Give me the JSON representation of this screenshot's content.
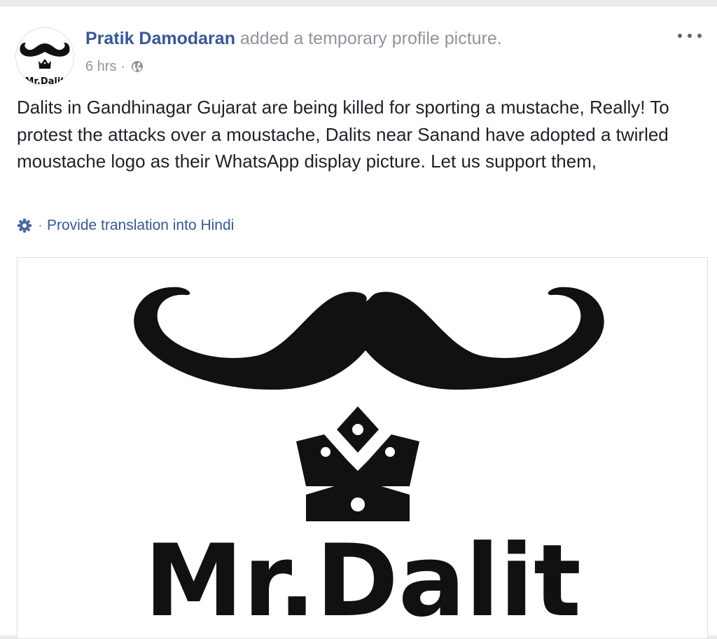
{
  "post": {
    "author_name": "Pratik Damodaran",
    "action_text": "added a temporary profile picture.",
    "time": "6 hrs",
    "separator": "·",
    "privacy_icon": "globe-icon",
    "more_icon": "more-options-icon",
    "body": "Dalits in Gandhinagar Gujarat are being killed for sporting a mustache, Really! To protest the attacks over a moustache, Dalits near Sanand have adopted a twirled moustache logo as their WhatsApp display picture. Let us support them,",
    "translation_link": "Provide translation into Hindi",
    "translation_icon": "gear-icon",
    "avatar_text": "Mr.Dalit",
    "photo_logo_text": "Mr.Dalit"
  },
  "colors": {
    "link_blue": "#365899",
    "meta_gray": "#90949c",
    "text": "#1d2129",
    "logo_black": "#111111",
    "page_bg": "#e9ebee"
  }
}
